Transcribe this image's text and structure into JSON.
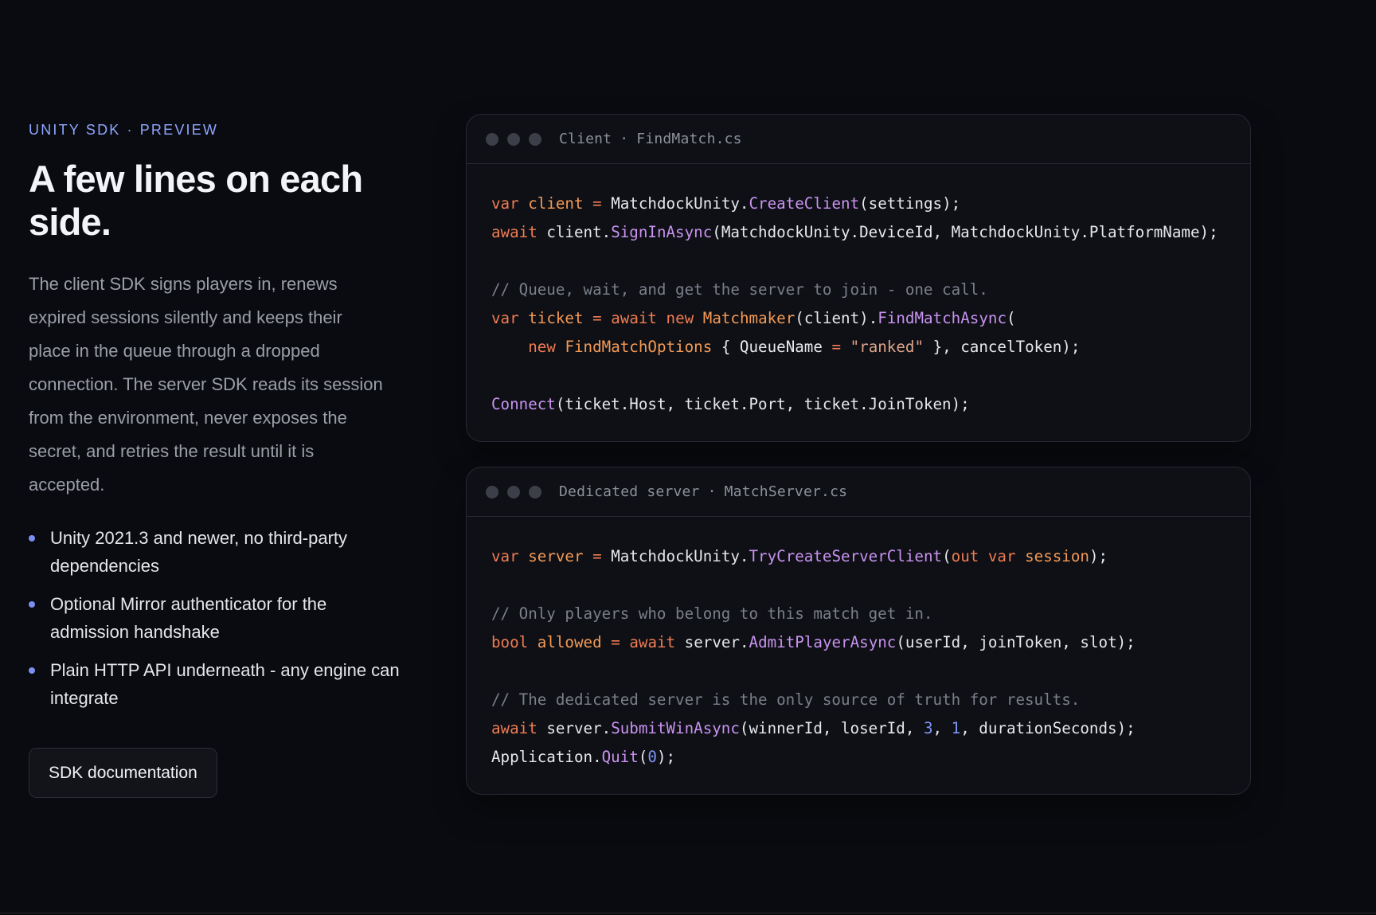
{
  "section": {
    "eyebrow_left": "UNITY SDK",
    "eyebrow_sep": "·",
    "eyebrow_right": "PREVIEW",
    "title": "A few lines on each side.",
    "description": "The client SDK signs players in, renews expired sessions silently and keeps their place in the queue through a dropped connection. The server SDK reads its session from the environment, never exposes the secret, and retries the result until it is accepted.",
    "features": [
      "Unity 2021.3 and newer, no third-party dependencies",
      "Optional Mirror authenticator for the admission handshake",
      "Plain HTTP API underneath - any engine can integrate"
    ],
    "button_label": "SDK documentation"
  },
  "client_card": {
    "label": "Client",
    "sep": "·",
    "filename": "FindMatch.cs"
  },
  "server_card": {
    "label": "Dedicated server",
    "sep": "·",
    "filename": "MatchServer.cs"
  },
  "colors": {
    "background": "#0a0b10",
    "accent": "#8fa6ff",
    "keyword": "#f07c52",
    "function": "#c993f0",
    "number": "#7f96f2"
  }
}
